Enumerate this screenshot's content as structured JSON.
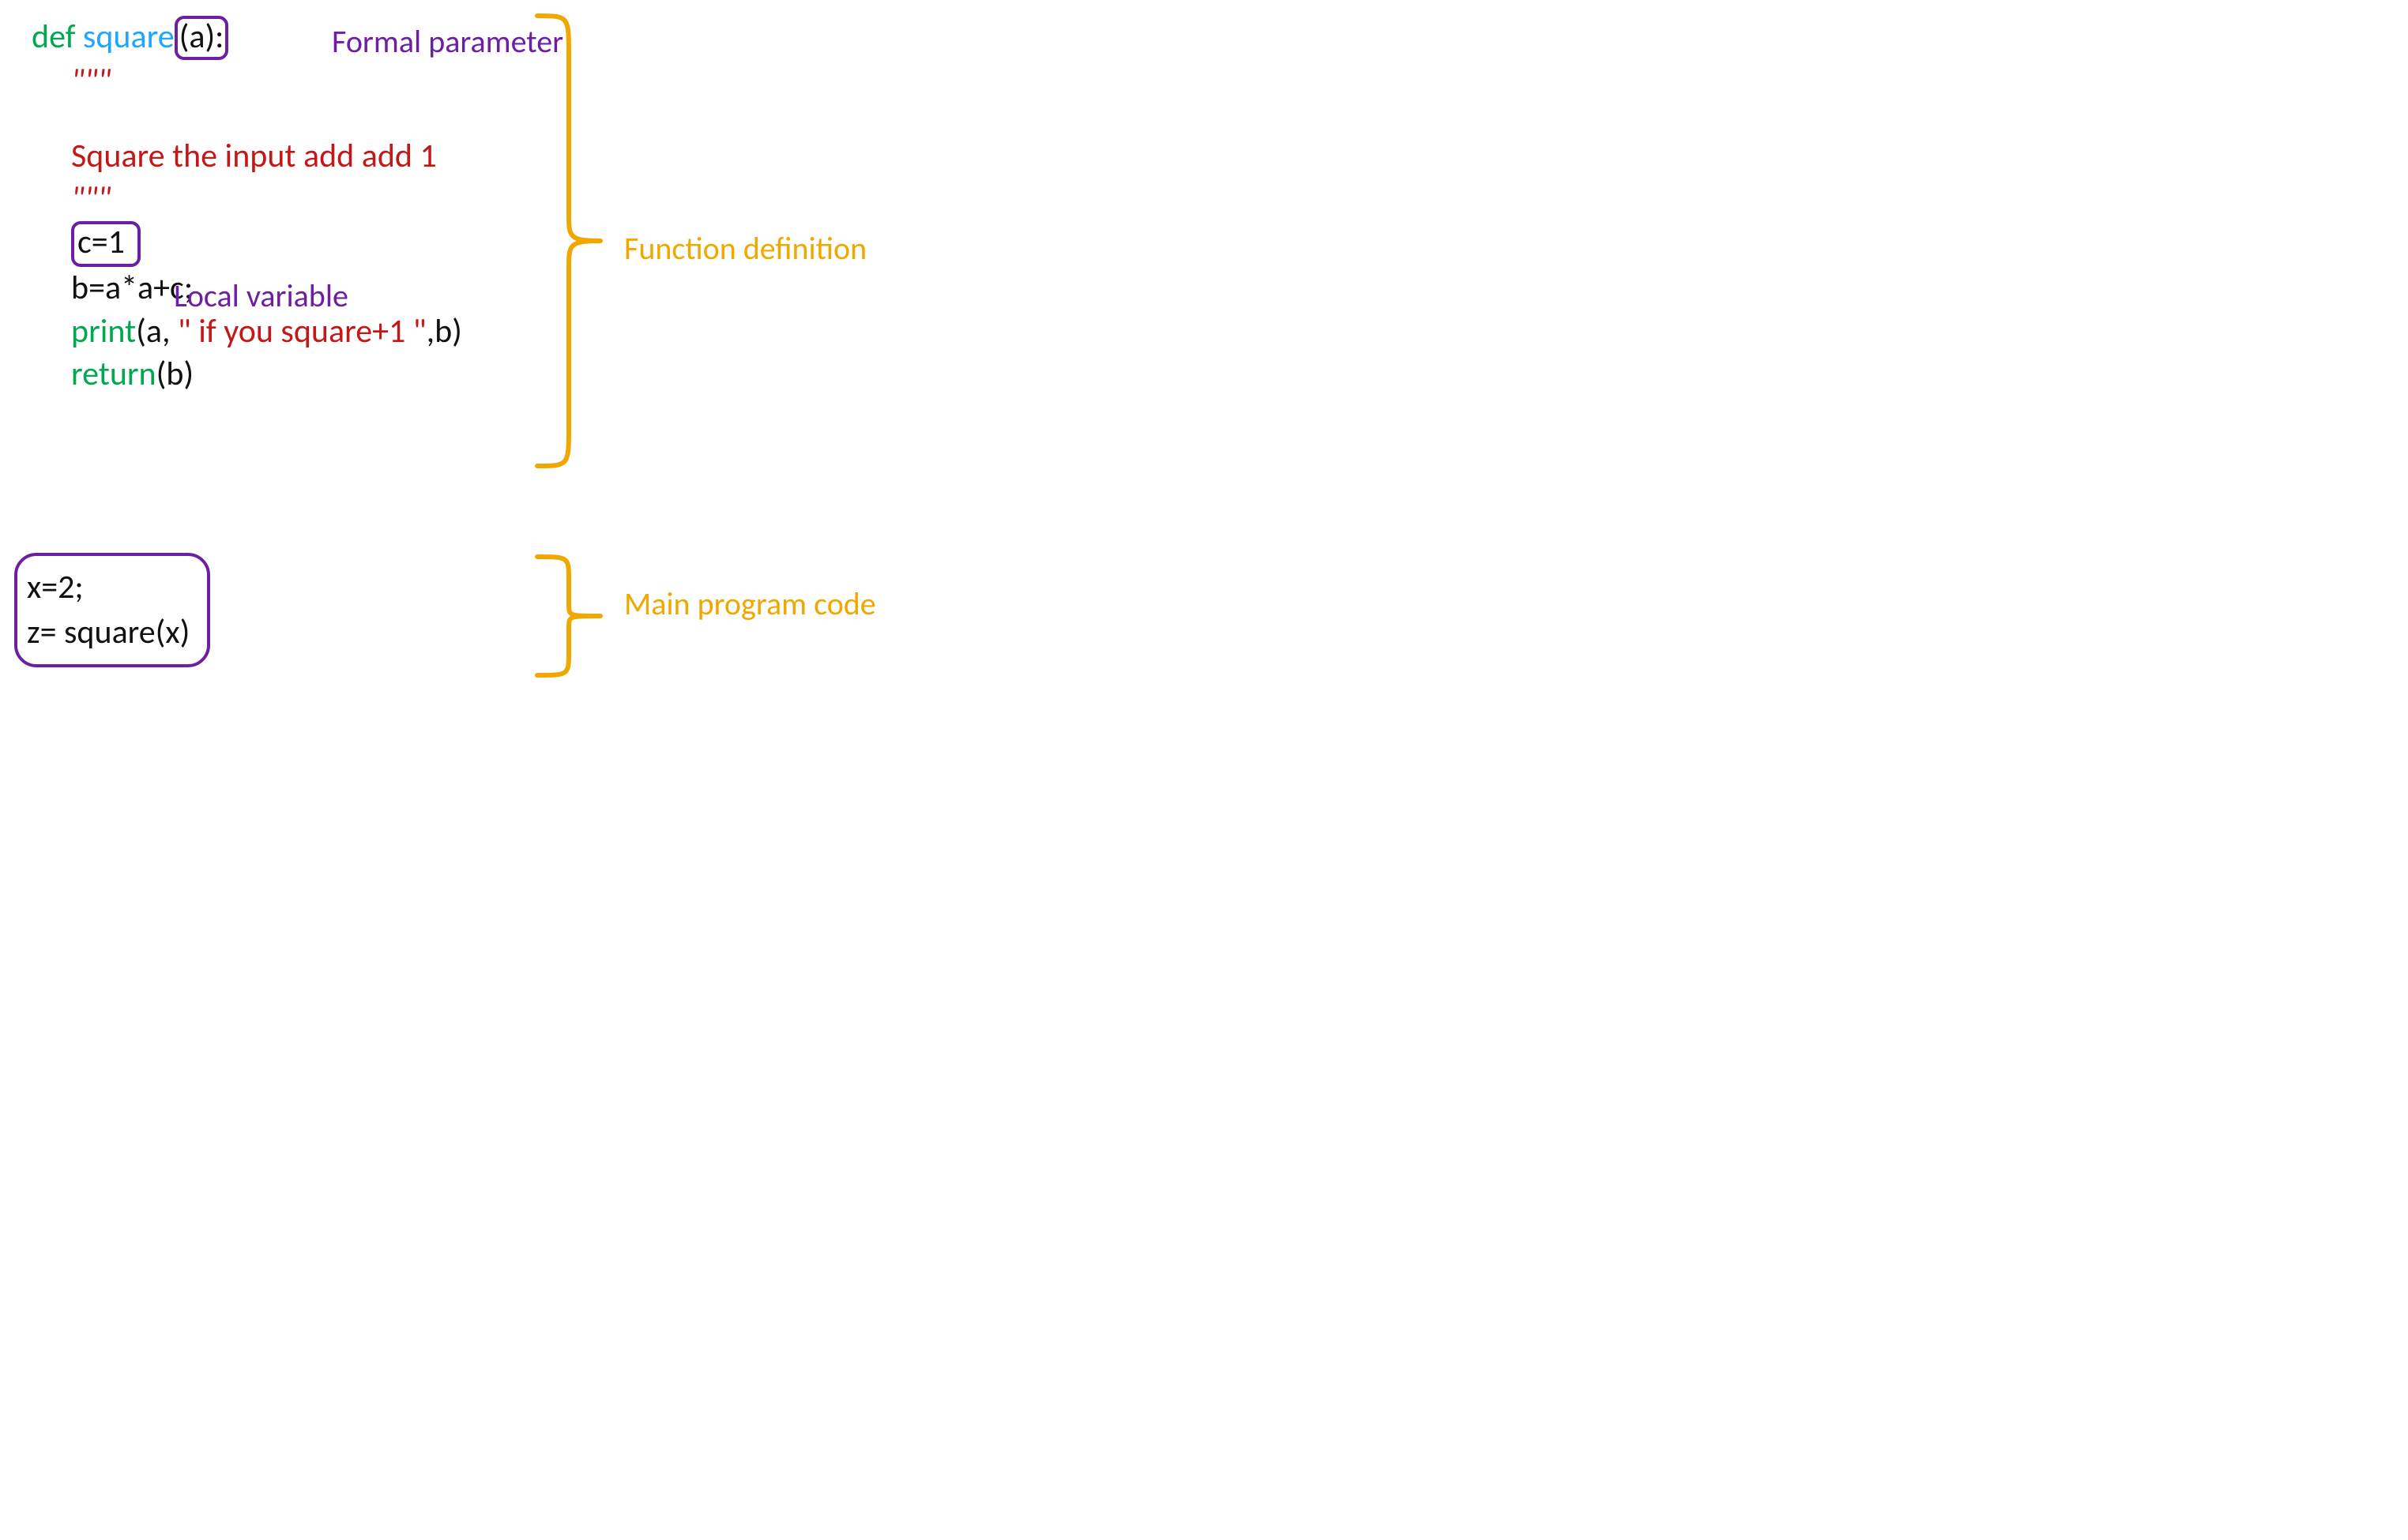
{
  "code": {
    "line1": {
      "def": "def ",
      "square": "square",
      "lpar_a_rpar_colon": "(a):"
    },
    "docq_open": "\"\"\"",
    "doc_body": "Square the input add add 1",
    "docq_close": "\"\"\"",
    "c1": "c=1",
    "b_eq": "b=a*a+c;",
    "print_kw": "print",
    "print_args_pre": "(a, ",
    "print_str": "\" if you square+1  \"",
    "print_args_post": ",b)",
    "return_kw": "return",
    "return_arg": "(b)",
    "main_x": "x=2;",
    "main_z": "z= square(x)"
  },
  "annotations": {
    "formal_param": "Formal parameter",
    "local_var": "Local variable",
    "func_def": "Function definition",
    "main_code": "Main program code"
  }
}
